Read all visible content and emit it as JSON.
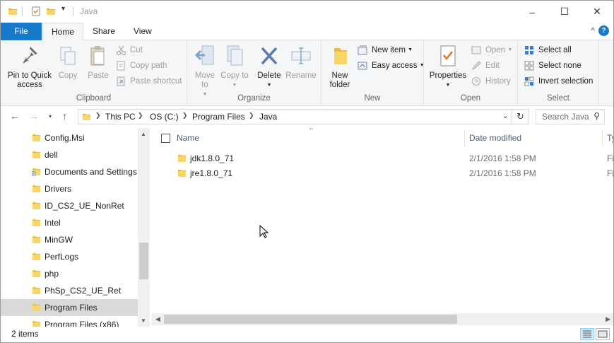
{
  "window": {
    "title": "Java",
    "controls": {
      "minimize": "–",
      "maximize": "☐",
      "close": "✕"
    }
  },
  "ribbon_tabs": [
    {
      "label": "File"
    },
    {
      "label": "Home"
    },
    {
      "label": "Share"
    },
    {
      "label": "View"
    }
  ],
  "clipboard": {
    "pin_label": "Pin to Quick access",
    "copy_label": "Copy",
    "paste_label": "Paste",
    "cut_label": "Cut",
    "copy_path_label": "Copy path",
    "paste_shortcut_label": "Paste shortcut",
    "group_label": "Clipboard"
  },
  "organize": {
    "move_to_label": "Move to",
    "copy_to_label": "Copy to",
    "delete_label": "Delete",
    "rename_label": "Rename",
    "group_label": "Organize"
  },
  "new_group": {
    "new_folder_label": "New folder",
    "new_item_label": "New item",
    "easy_access_label": "Easy access",
    "group_label": "New"
  },
  "open_group": {
    "properties_label": "Properties",
    "open_label": "Open",
    "edit_label": "Edit",
    "history_label": "History",
    "group_label": "Open"
  },
  "select_group": {
    "select_all_label": "Select all",
    "select_none_label": "Select none",
    "invert_label": "Invert selection",
    "group_label": "Select"
  },
  "address": {
    "crumbs": [
      "This PC",
      "OS (C:)",
      "Program Files",
      "Java"
    ],
    "search_placeholder": "Search Java"
  },
  "nav_pane": {
    "items": [
      {
        "label": "Config.Msi"
      },
      {
        "label": "dell"
      },
      {
        "label": "Documents and Settings"
      },
      {
        "label": "Drivers"
      },
      {
        "label": "ID_CS2_UE_NonRet"
      },
      {
        "label": "Intel"
      },
      {
        "label": "MinGW"
      },
      {
        "label": "PerfLogs"
      },
      {
        "label": "php"
      },
      {
        "label": "PhSp_CS2_UE_Ret"
      },
      {
        "label": "Program Files"
      },
      {
        "label": "Program Files (x86)"
      }
    ],
    "selected": "Program Files"
  },
  "columns": {
    "name": "Name",
    "date": "Date modified",
    "type": "Ty"
  },
  "files": [
    {
      "name": "jdk1.8.0_71",
      "date": "2/1/2016 1:58 PM",
      "type": "Fi"
    },
    {
      "name": "jre1.8.0_71",
      "date": "2/1/2016 1:58 PM",
      "type": "Fi"
    }
  ],
  "status": {
    "count": "2 items"
  },
  "colors": {
    "accent": "#1979ca",
    "folder": "#f8d568",
    "selected_bg": "#d9d9d9"
  },
  "icons": [
    "folder-icon",
    "pin-icon",
    "copy-icon",
    "paste-icon",
    "cut-icon",
    "delete-icon",
    "rename-icon",
    "properties-icon",
    "new-folder-icon"
  ]
}
